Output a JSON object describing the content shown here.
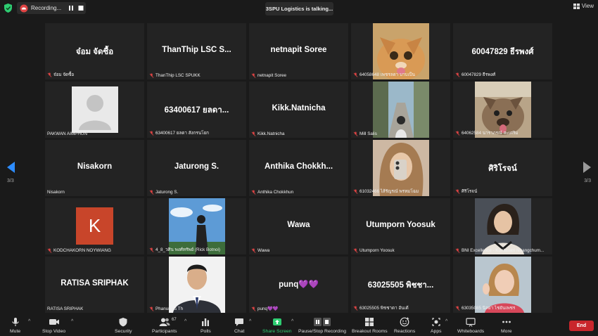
{
  "topbar": {
    "recording_label": "Recording...",
    "talking_label": "3SPU Logistics is talking...",
    "view_label": "View"
  },
  "pagination": {
    "left": "3/3",
    "right": "3/3"
  },
  "tiles": [
    {
      "big": "จ๋อม จัดซื้อ",
      "label": "จ๋อม จัดซื้อ"
    },
    {
      "big": "ThanThip  LSC S...",
      "label": "ThanThip LSC SPUKK"
    },
    {
      "big": "netnapit Soree",
      "label": "netnapit Soree"
    },
    {
      "big": "",
      "label": "64058648 เพชรลดา บาบเป็น"
    },
    {
      "big": "60047829 ธีรพงศ์",
      "label": "60047829 ธีรพงศ์"
    },
    {
      "big": "",
      "label": "PAKWAN AIMPHUN"
    },
    {
      "big": "63400617 ยลดา...",
      "label": "63400617 ยลดา สังกรนโยก"
    },
    {
      "big": "Kikk.Natnicha",
      "label": "Kikk.Natnicha"
    },
    {
      "big": "",
      "label": "Mill Salis"
    },
    {
      "big": "",
      "label": "64062584 นาราภรณ์ สะเศริม"
    },
    {
      "big": "Nisakorn",
      "label": "Nisakorn"
    },
    {
      "big": "Jaturong S.",
      "label": "Jaturong S."
    },
    {
      "big": "Anthika  Chokkh...",
      "label": "Anthika Chokkhun"
    },
    {
      "big": "",
      "label": "61032466 ไส้รัญรณ์ พรหมโฉม"
    },
    {
      "big": "ศิริโรจน์",
      "label": "ศิริโรจน์"
    },
    {
      "big": "",
      "label": "KODCHAKORN NOYWIANG"
    },
    {
      "big": "",
      "label": "4_8_วศิน พงศ์ทรัพย์ (Rick Botnoi)"
    },
    {
      "big": "Wawa",
      "label": "Wawa"
    },
    {
      "big": "Utumporn Yoosuk",
      "label": "Utumporn Yoosuk"
    },
    {
      "big": "",
      "label": "BNI Excellence - Kunlasatri Nuangchum..."
    },
    {
      "big": "RATISA SRIPHAK",
      "label": "RATISA SRIPHAK"
    },
    {
      "big": "",
      "label": "Phanumas Th"
    },
    {
      "big": "punq💜💜",
      "label": "punq💜💜"
    },
    {
      "big": "63025505 พิชชา...",
      "label": "63025505 พิชชาดา อันเต้"
    },
    {
      "big": "",
      "label": "63035085 นิลยา ไชยันเพชร"
    }
  ],
  "avatar_letter": "K",
  "toolbar": {
    "mute": "Mute",
    "stop_video": "Stop Video",
    "security": "Security",
    "participants": "Participants",
    "participants_count": "67",
    "polls": "Polls",
    "chat": "Chat",
    "share_screen": "Share Screen",
    "pause_recording": "Pause/Stop Recording",
    "breakout_rooms": "Breakout Rooms",
    "reactions": "Reactions",
    "apps": "Apps",
    "whiteboards": "Whiteboards",
    "more": "More",
    "end": "End"
  },
  "colors": {
    "background": "#1a1a1a",
    "tile": "#232323",
    "end_button": "#c9262c",
    "share_green": "#2ecc71",
    "avatar_orange": "#c8452a"
  }
}
